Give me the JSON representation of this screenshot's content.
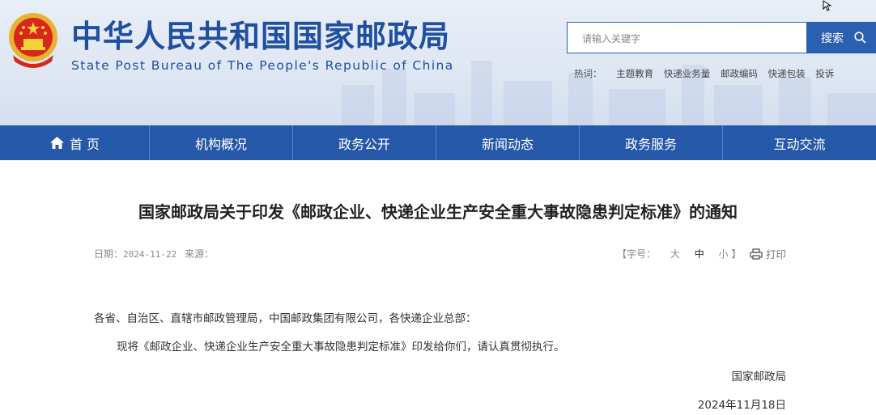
{
  "header": {
    "site_title": "中华人民共和国国家邮政局",
    "site_subtitle": "State Post Bureau of The People's Republic of China",
    "search": {
      "placeholder": "请输入关键字",
      "button_label": "搜索"
    },
    "hotwords": {
      "label": "热词：",
      "items": [
        "主题教育",
        "快递业务量",
        "邮政编码",
        "快递包装",
        "投诉"
      ]
    }
  },
  "nav": {
    "items": [
      {
        "label": "首 页",
        "icon": "home-icon"
      },
      {
        "label": "机构概况"
      },
      {
        "label": "政务公开"
      },
      {
        "label": "新闻动态"
      },
      {
        "label": "政务服务"
      },
      {
        "label": "互动交流"
      }
    ]
  },
  "article": {
    "title": "国家邮政局关于印发《邮政企业、快递企业生产安全重大事故隐患判定标准》的通知",
    "meta": {
      "date_label": "日期：",
      "date": "2024-11-22",
      "source_label": "来源："
    },
    "font_size": {
      "open": "【字号：",
      "large": "大",
      "medium": "中",
      "small": "小",
      "close": "】"
    },
    "print_label": "打印",
    "salutation": "各省、自治区、直辖市邮政管理局，中国邮政集团有限公司，各快递企业总部：",
    "body": "现将《邮政企业、快递企业生产安全重大事故隐患判定标准》印发给你们，请认真贯彻执行。",
    "signature": "国家邮政局",
    "sign_date": "2024年11月18日"
  },
  "colors": {
    "brand_blue": "#2558a8",
    "title_blue": "#1f4fa0"
  }
}
